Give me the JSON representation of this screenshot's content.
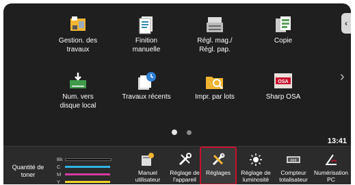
{
  "tiles": [
    {
      "label_line1": "Gestion. des",
      "label_line2": "travaux",
      "icon": "job-status-icon"
    },
    {
      "label_line1": "Finition",
      "label_line2": "manuelle",
      "icon": "manual-finishing-icon"
    },
    {
      "label_line1": "Régl. mag./",
      "label_line2": "Régl. pap.",
      "icon": "tray-settings-icon"
    },
    {
      "label_line1": "Copie",
      "label_line2": "",
      "icon": "copy-icon"
    },
    {
      "label_line1": "Num. vers",
      "label_line2": "disque local",
      "icon": "scan-to-local-drive-icon"
    },
    {
      "label_line1": "Travaux récents",
      "label_line2": "",
      "icon": "recent-jobs-icon"
    },
    {
      "label_line1": "Impr. par lots",
      "label_line2": "",
      "icon": "bulk-print-icon"
    },
    {
      "label_line1": "Sharp OSA",
      "label_line2": "",
      "icon": "sharp-osa-icon"
    }
  ],
  "page_indicator": {
    "pages": 2,
    "current": 1
  },
  "clock": "13:41",
  "toner": {
    "label_line1": "Quantité de",
    "label_line2": "toner",
    "levels": [
      {
        "key": "Bk",
        "color": "#1a1a1a",
        "level": 1.0
      },
      {
        "key": "C",
        "color": "#2fb5e6",
        "level": 1.0
      },
      {
        "key": "M",
        "color": "#d63aa0",
        "level": 1.0
      },
      {
        "key": "Y",
        "color": "#f2d22b",
        "level": 1.0
      }
    ]
  },
  "dock": [
    {
      "line1": "Manuel",
      "line2": "utilisateur",
      "icon": "user-manual-icon"
    },
    {
      "line1": "Réglage de",
      "line2": "l'appareil",
      "icon": "device-settings-icon"
    },
    {
      "line1": "Réglages",
      "line2": "",
      "icon": "settings-tools-icon",
      "selected": true
    },
    {
      "line1": "Réglage de",
      "line2": "luminosité",
      "icon": "brightness-icon"
    },
    {
      "line1": "Compteur",
      "line2": "totalisateur",
      "icon": "counter-icon"
    },
    {
      "line1": "Numérisation",
      "line2": "PC",
      "icon": "pc-scan-icon"
    }
  ],
  "colors": {
    "highlight": "#c8102e",
    "screen_bg": "#1f1f1f"
  }
}
